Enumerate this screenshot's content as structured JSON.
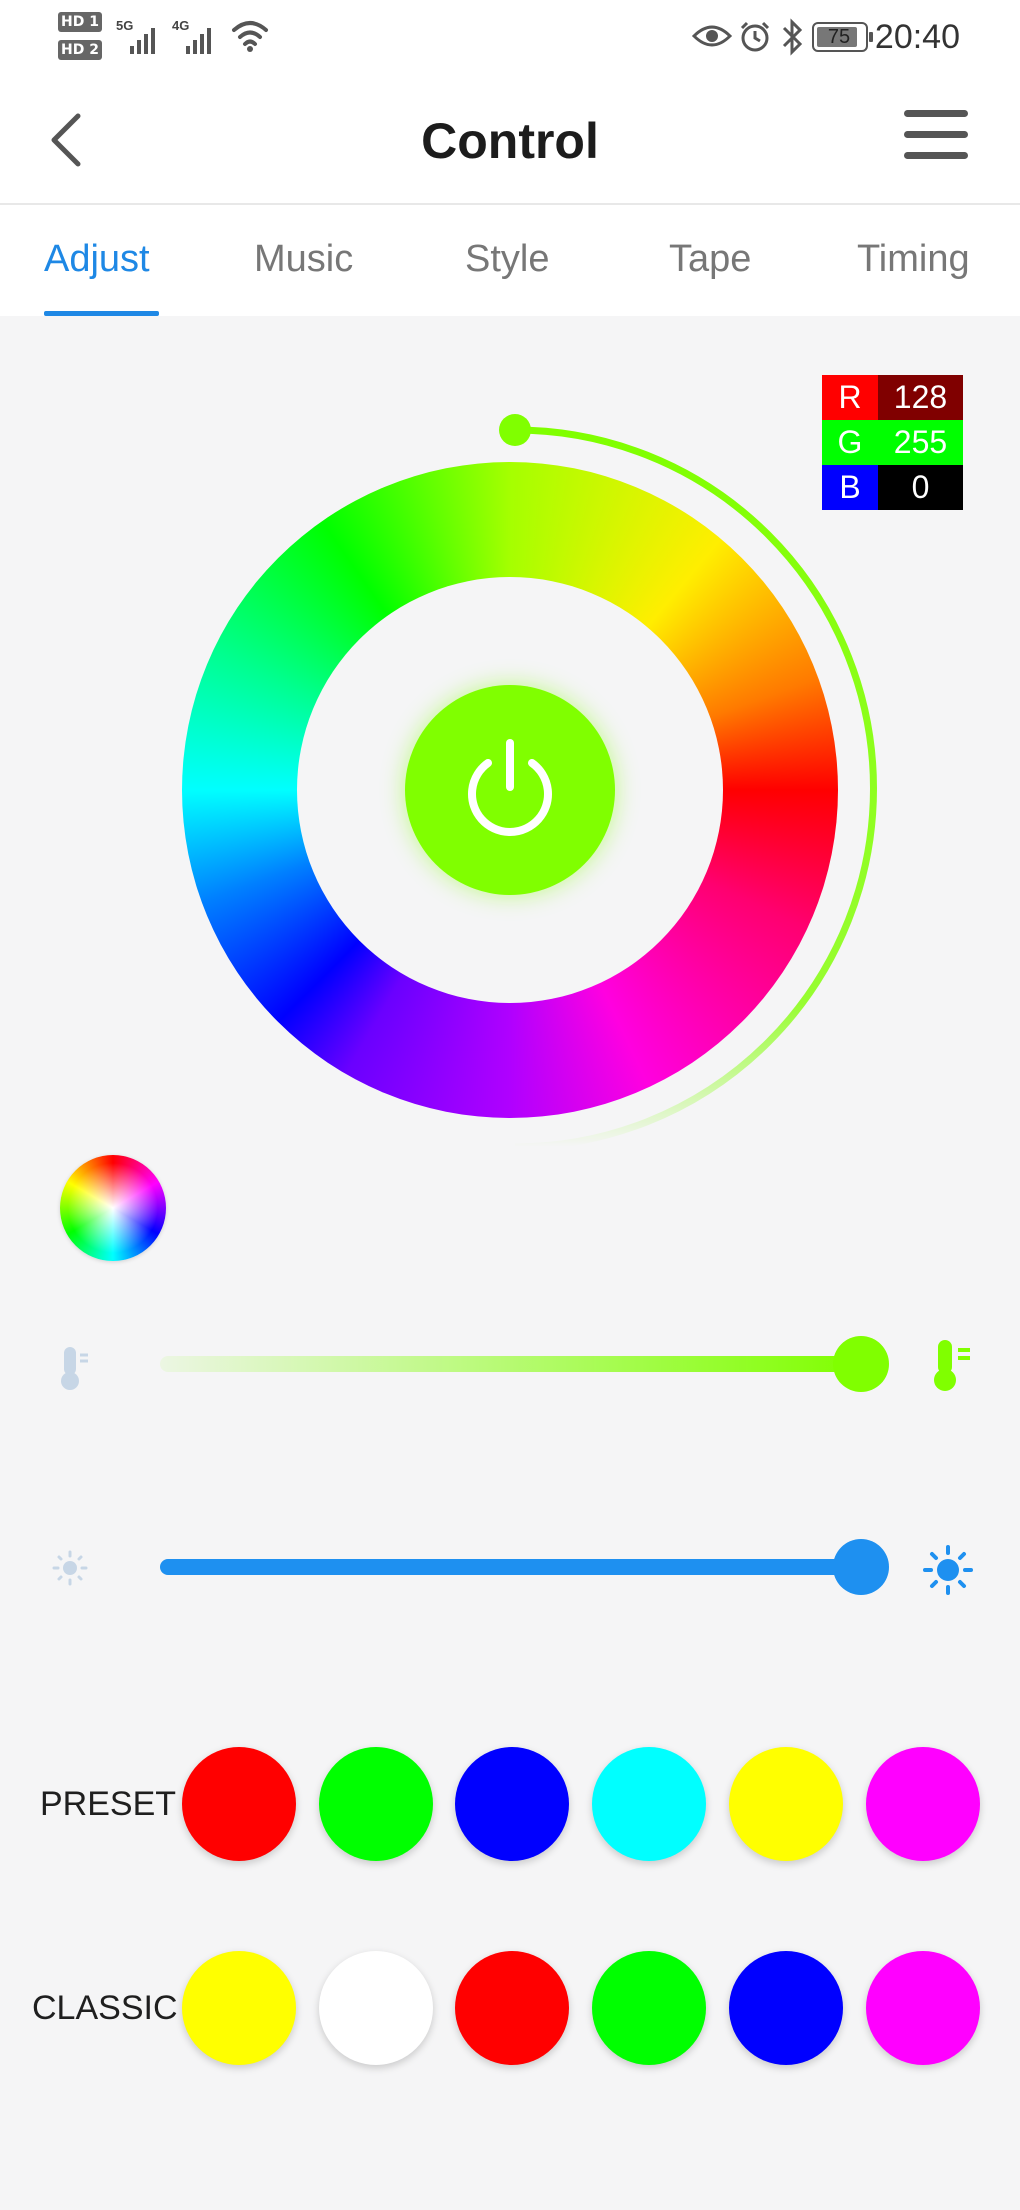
{
  "status_bar": {
    "hd1": "HD 1",
    "hd2": "HD 2",
    "net1": "5G",
    "net2": "4G",
    "battery": "75",
    "time": "20:40"
  },
  "header": {
    "title": "Control"
  },
  "tabs": [
    {
      "label": "Adjust",
      "active": true
    },
    {
      "label": "Music"
    },
    {
      "label": "Style"
    },
    {
      "label": "Tape"
    },
    {
      "label": "Timing"
    }
  ],
  "rgb_readout": {
    "r_label": "R",
    "r_value": "128",
    "g_label": "G",
    "g_value": "255",
    "b_label": "B",
    "b_value": "0"
  },
  "current_color": "#80ff00",
  "sliders": {
    "color_temperature": {
      "value_percent": 100,
      "color": "#80ff00"
    },
    "brightness": {
      "value_percent": 100,
      "color": "#1e90f0"
    }
  },
  "preset": {
    "label": "PRESET",
    "colors": [
      "#ff0000",
      "#00ff00",
      "#0000ff",
      "#00ffff",
      "#ffff00",
      "#ff00ff"
    ]
  },
  "classic": {
    "label": "CLASSIC",
    "colors": [
      "#ffff00",
      "#ffffff",
      "#ff0000",
      "#00ff00",
      "#0000ff",
      "#ff00ff"
    ]
  }
}
